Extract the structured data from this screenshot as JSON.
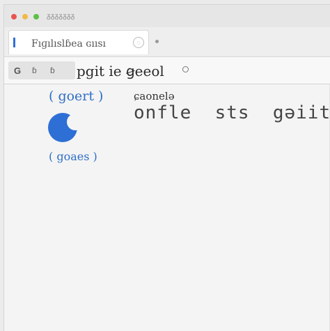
{
  "window": {
    "title": "ᵹᵹᵹᵹᵹᵹᵹ"
  },
  "tab": {
    "label": "Fıɡılıslɓea ɢıısı",
    "close_glyph": "◌"
  },
  "addressbar": {
    "nav_g": "G",
    "nav_d": "ɓ",
    "nav_b": "ɓ",
    "url": "pgit ie  ꞡeeol"
  },
  "content": {
    "link_top": "( goert )",
    "heading_small": "ɕaonelə",
    "heading_large": "onfle  sts  gəiit",
    "link_bottom": "( goaes )"
  },
  "colors": {
    "accent": "#2e6fd6",
    "link": "#2f6ec6"
  },
  "icons": {
    "moon": "moon-icon"
  }
}
